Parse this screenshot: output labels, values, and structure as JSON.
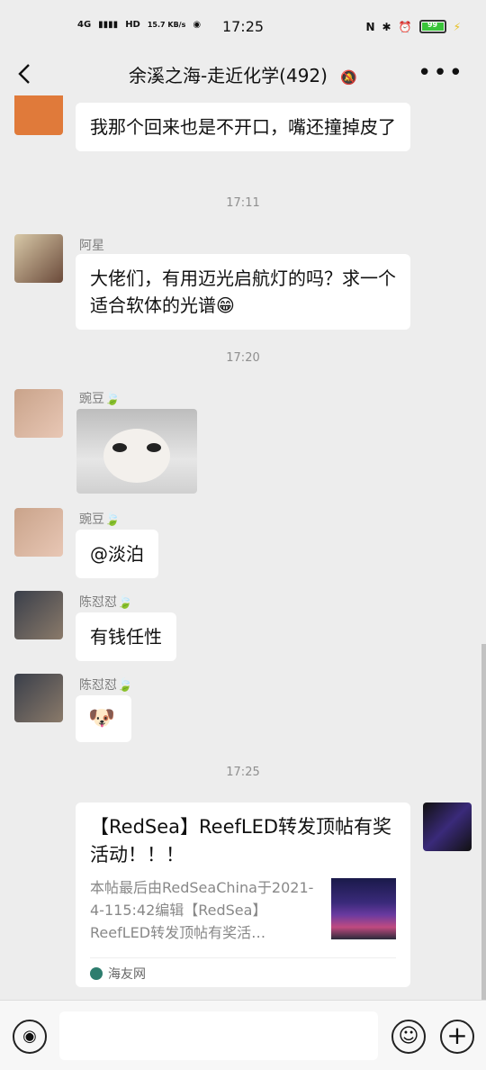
{
  "status_bar": {
    "network": "4G",
    "hd": "HD",
    "speed": "15.7 KB/s",
    "time": "17:25",
    "battery": "99"
  },
  "header": {
    "back_icon": "chevron-left-icon",
    "title": "余溪之海-走近化学(492)",
    "mute_icon": "bell-off-icon",
    "more_icon": "more-icon"
  },
  "messages": [
    {
      "type": "text",
      "text": "我那个回来也是不开口，嘴还撞掉皮了"
    },
    {
      "type": "time",
      "text": "17:11"
    },
    {
      "type": "text",
      "sender": "阿星",
      "text": "大佬们，有用迈光启航灯的吗？求一个适合软体的光谱😁"
    },
    {
      "type": "time",
      "text": "17:20"
    },
    {
      "type": "image",
      "sender": "豌豆🍃"
    },
    {
      "type": "text",
      "sender": "豌豆🍃",
      "text": "@淡泊"
    },
    {
      "type": "text",
      "sender": "陈怼怼🍃",
      "text": "有钱任性"
    },
    {
      "type": "text",
      "sender": "陈怼怼🍃",
      "text": "🐶"
    },
    {
      "type": "time",
      "text": "17:25"
    },
    {
      "type": "link",
      "title": "【RedSea】ReefLED转发顶帖有奖活动！！！",
      "description": "本帖最后由RedSeaChina于2021-4-115:42编辑【RedSea】ReefLED转发顶帖有奖活…",
      "source": "海友网"
    }
  ],
  "bottom_bar": {
    "voice_icon": "voice-icon",
    "emoji_icon": "emoji-icon",
    "plus_icon": "plus-icon"
  },
  "colors": {
    "background": "#ededed",
    "bubble": "#ffffff",
    "battery": "#3ac43a"
  }
}
